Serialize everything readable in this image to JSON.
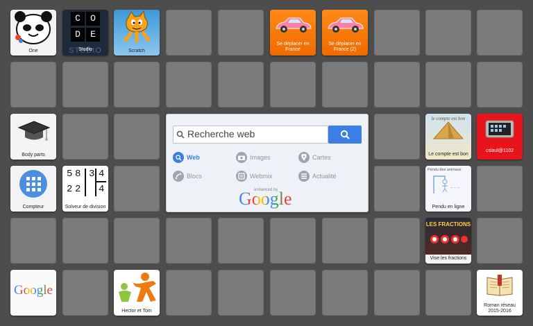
{
  "tiles": {
    "one": {
      "label": "One"
    },
    "studio": {
      "label": "Studio",
      "art_text": [
        "C",
        "O",
        "D",
        "E"
      ],
      "watermark": "STUDIO"
    },
    "scratch": {
      "label": "Scratch"
    },
    "deplacer1": {
      "label": "Se déplacer en France"
    },
    "deplacer2": {
      "label": "Se déplacer en France (2)"
    },
    "bodyparts": {
      "label": "Body parts"
    },
    "compte": {
      "label": "Le compte est bon",
      "art_text": "le compte est bon"
    },
    "tablet": {
      "label": "cslaul@1102"
    },
    "compteur": {
      "label": "Compteur"
    },
    "solveur": {
      "label": "Solveur de division",
      "art_text": [
        "5",
        "8",
        "3",
        "4",
        "2",
        "2",
        "4"
      ]
    },
    "pendu": {
      "label": "Pendu en ligne",
      "art_text": "Pendu des animaux"
    },
    "fractions": {
      "label": "Vise les fractions",
      "art_text": "LES FRACTIONS"
    },
    "google": {
      "label": "",
      "logo": "Google"
    },
    "hector": {
      "label": "Hector et Tom"
    },
    "roman": {
      "label": "Roman réseau 2015-2016"
    }
  },
  "search": {
    "placeholder": "Recherche web",
    "options": [
      {
        "label": "Web",
        "icon": "search-icon",
        "active": true
      },
      {
        "label": "Images",
        "icon": "camera-icon",
        "active": false
      },
      {
        "label": "Cartes",
        "icon": "map-pin-icon",
        "active": false
      },
      {
        "label": "Blocs",
        "icon": "link-icon",
        "active": false
      },
      {
        "label": "Webmix",
        "icon": "webmix-icon",
        "active": false
      },
      {
        "label": "Actualité",
        "icon": "list-icon",
        "active": false
      }
    ],
    "enhanced_by": "enhanced by",
    "google_logo": "Google"
  },
  "colors": {
    "accent": "#3b7fe6",
    "orange": "#f57a0a",
    "red": "#e8141c",
    "empty_cell": "#7b7b7b"
  }
}
